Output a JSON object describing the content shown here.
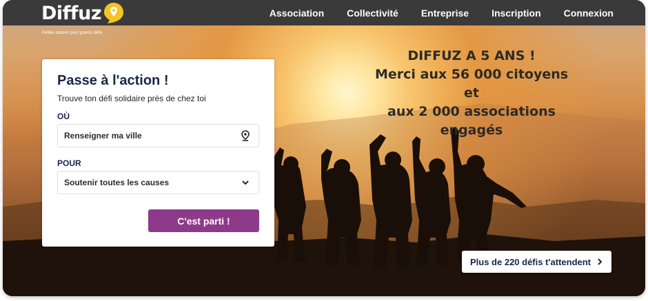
{
  "brand": {
    "name": "Diffuz",
    "tagline": "Petites actions pour grands défis",
    "accent": "#f6c324"
  },
  "nav": {
    "items": [
      {
        "label": "Association"
      },
      {
        "label": "Collectivité"
      },
      {
        "label": "Entreprise"
      },
      {
        "label": "Inscription"
      },
      {
        "label": "Connexion"
      }
    ]
  },
  "hero": {
    "line1": "DIFFUZ A 5 ANS !",
    "line2": "Merci aux 56 000 citoyens et",
    "line3": "aux 2 000 associations engagés"
  },
  "search_card": {
    "title": "Passe à l'action !",
    "subtitle": "Trouve ton défi solidaire près de chez toi",
    "where_label": "OÙ",
    "where_placeholder": "Renseigner ma ville",
    "where_icon": "location-pin-icon",
    "cause_label": "POUR",
    "cause_value": "Soutenir toutes les causes",
    "cause_icon": "chevron-down-icon",
    "submit_label": "C'est parti !",
    "submit_color": "#8e3a8a"
  },
  "challenges_button": {
    "label": "Plus de 220 défis t'attendent",
    "icon": "chevron-right-icon"
  }
}
